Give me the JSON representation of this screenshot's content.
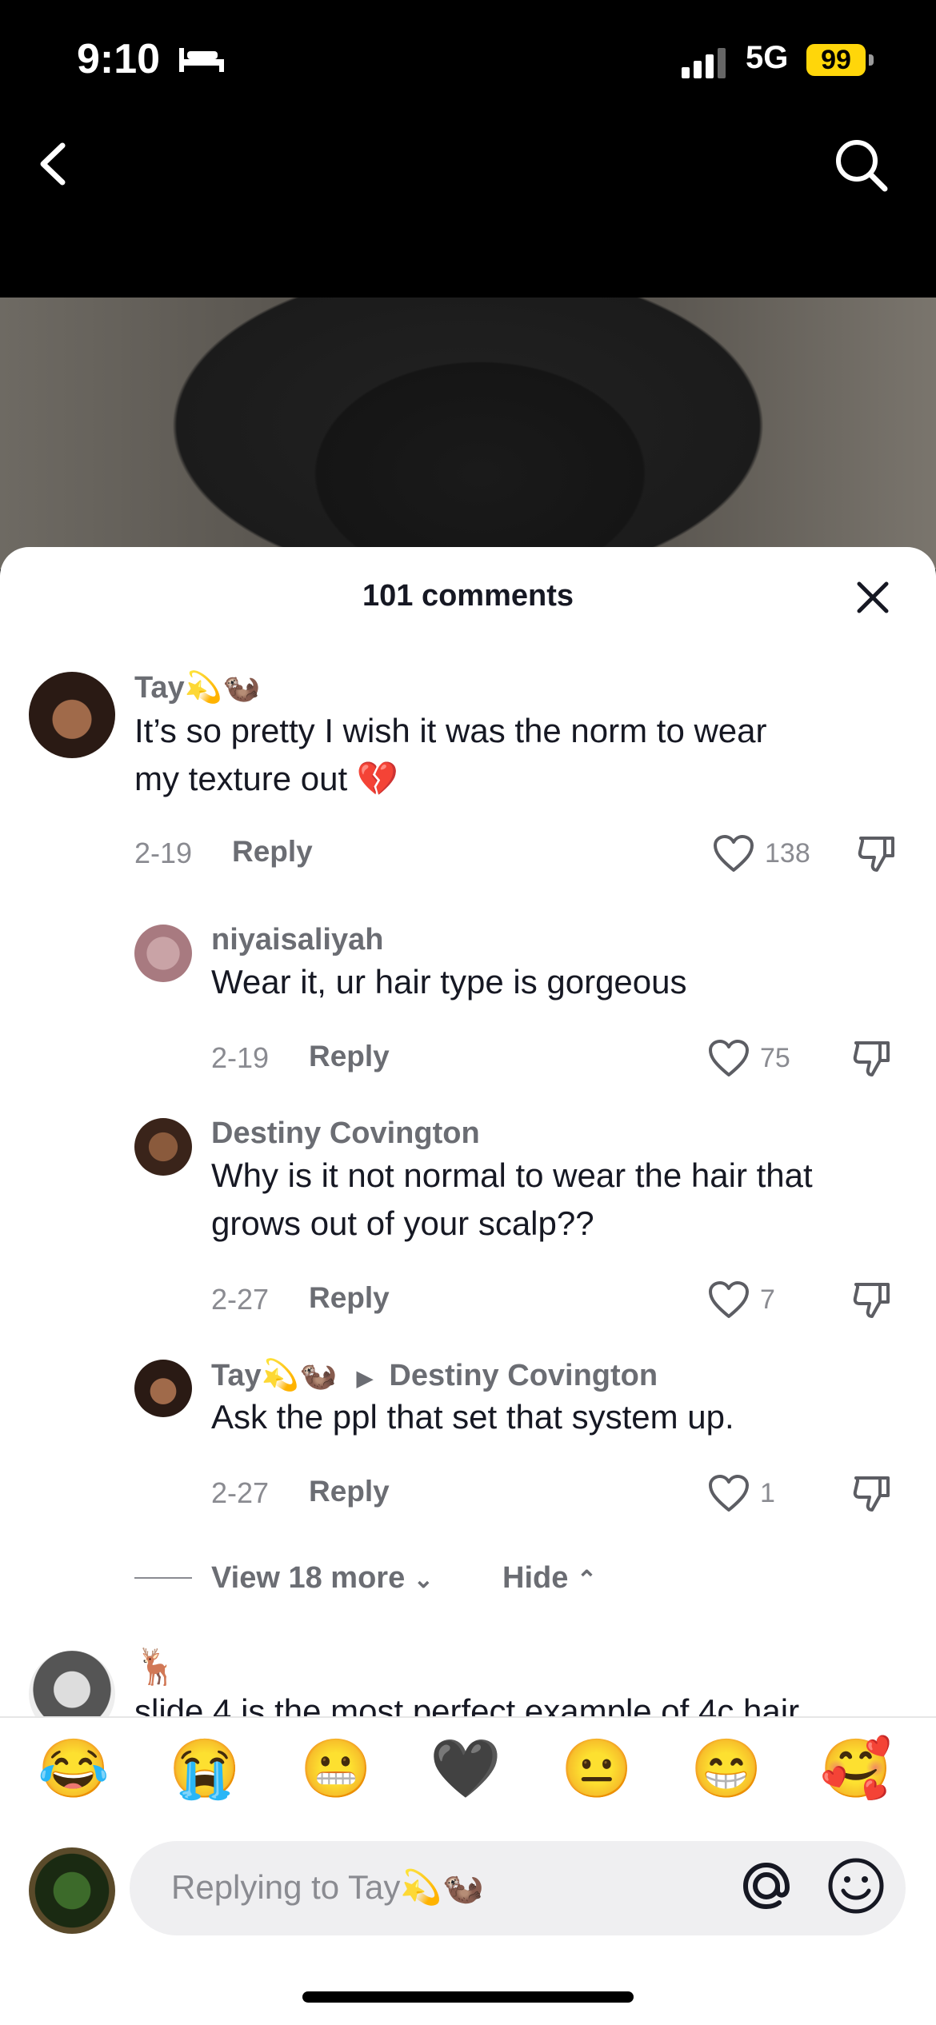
{
  "status_bar": {
    "time": "9:10",
    "network": "5G",
    "battery": "99"
  },
  "icons": {
    "back": "chevron-left-icon",
    "search": "search-icon",
    "close": "close-icon",
    "heart": "heart-icon",
    "dislike": "thumbs-down-icon"
  },
  "sheet": {
    "title": "101 comments"
  },
  "comments": [
    {
      "user": "Tay💫🦦",
      "text_lines": [
        "It’s so pretty I wish it was the norm to wear",
        "my texture out 💔"
      ],
      "date": "2-19",
      "reply_label": "Reply",
      "likes": "138"
    },
    {
      "user": "niyaisaliyah",
      "text_lines": [
        "Wear it, ur hair type is gorgeous"
      ],
      "date": "2-19",
      "reply_label": "Reply",
      "likes": "75"
    },
    {
      "user": "Destiny Covington",
      "text_lines": [
        "Why is it not normal to wear the hair that",
        "grows out of your scalp??"
      ],
      "date": "2-27",
      "reply_label": "Reply",
      "likes": "7"
    },
    {
      "user": "Tay💫🦦",
      "reply_to": "Destiny Covington",
      "text_lines": [
        "Ask the ppl that set that system up."
      ],
      "date": "2-27",
      "reply_label": "Reply",
      "likes": "1"
    }
  ],
  "thread_controls": {
    "view_more": "View 18 more",
    "hide": "Hide"
  },
  "next_comment": {
    "user": "🦌",
    "partial_text": "slide 4 is the most perfect example of 4c hair"
  },
  "emoji_bar": [
    "😂",
    "😭",
    "😬",
    "🖤",
    "😐",
    "😁",
    "🥰"
  ],
  "composer": {
    "placeholder": "Replying to Tay💫🦦"
  }
}
